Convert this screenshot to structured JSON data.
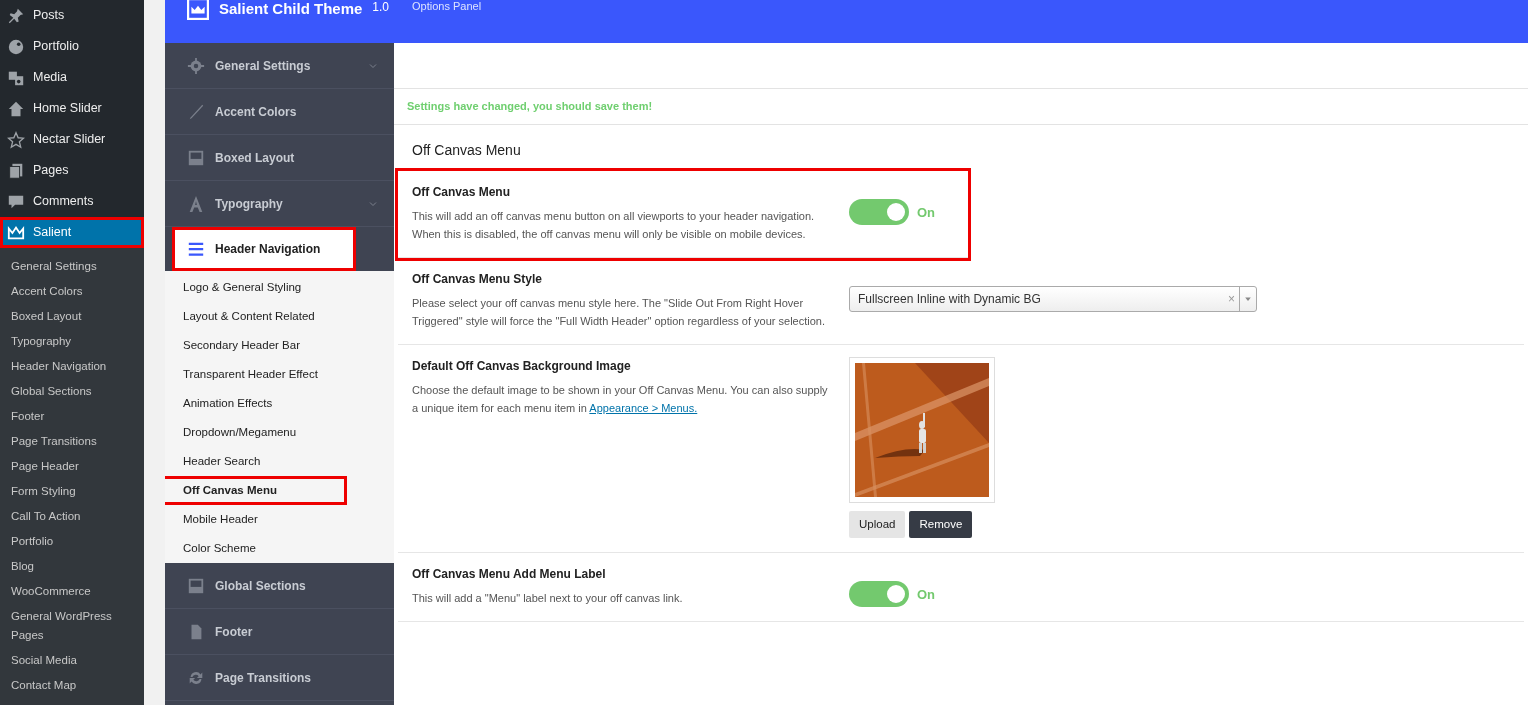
{
  "admin_menu": {
    "items": [
      {
        "label": "Posts",
        "selected": false,
        "highlighted": false
      },
      {
        "label": "Portfolio",
        "selected": false,
        "highlighted": false
      },
      {
        "label": "Media",
        "selected": false,
        "highlighted": false
      },
      {
        "label": "Home Slider",
        "selected": false,
        "highlighted": false
      },
      {
        "label": "Nectar Slider",
        "selected": false,
        "highlighted": false
      },
      {
        "label": "Pages",
        "selected": false,
        "highlighted": false
      },
      {
        "label": "Comments",
        "selected": false,
        "highlighted": false
      },
      {
        "label": "Salient",
        "selected": true,
        "highlighted": true
      }
    ],
    "submenu": [
      "General Settings",
      "Accent Colors",
      "Boxed Layout",
      "Typography",
      "Header Navigation",
      "Global Sections",
      "Footer",
      "Page Transitions",
      "Page Header",
      "Form Styling",
      "Call To Action",
      "Portfolio",
      "Blog",
      "WooCommerce",
      "General WordPress Pages",
      "Social Media",
      "Contact Map"
    ]
  },
  "header": {
    "title": "Salient Child Theme",
    "version": "1.0",
    "subtitle": "Options Panel"
  },
  "sections": [
    {
      "label": "General Settings",
      "selected": false,
      "highlighted": false,
      "expandable": true
    },
    {
      "label": "Accent Colors",
      "selected": false,
      "highlighted": false,
      "expandable": false
    },
    {
      "label": "Boxed Layout",
      "selected": false,
      "highlighted": false,
      "expandable": false
    },
    {
      "label": "Typography",
      "selected": false,
      "highlighted": false,
      "expandable": true
    },
    {
      "label": "Header Navigation",
      "selected": true,
      "highlighted": true,
      "expandable": false,
      "children": [
        {
          "label": "Logo & General Styling",
          "selected": false,
          "highlighted": false
        },
        {
          "label": "Layout & Content Related",
          "selected": false,
          "highlighted": false
        },
        {
          "label": "Secondary Header Bar",
          "selected": false,
          "highlighted": false
        },
        {
          "label": "Transparent Header Effect",
          "selected": false,
          "highlighted": false
        },
        {
          "label": "Animation Effects",
          "selected": false,
          "highlighted": false
        },
        {
          "label": "Dropdown/Megamenu",
          "selected": false,
          "highlighted": false
        },
        {
          "label": "Header Search",
          "selected": false,
          "highlighted": false
        },
        {
          "label": "Off Canvas Menu",
          "selected": true,
          "highlighted": true
        },
        {
          "label": "Mobile Header",
          "selected": false,
          "highlighted": false
        },
        {
          "label": "Color Scheme",
          "selected": false,
          "highlighted": false
        }
      ]
    },
    {
      "label": "Global Sections",
      "selected": false,
      "highlighted": false,
      "expandable": false
    },
    {
      "label": "Footer",
      "selected": false,
      "highlighted": false,
      "expandable": false
    },
    {
      "label": "Page Transitions",
      "selected": false,
      "highlighted": false,
      "expandable": false
    }
  ],
  "notice": "Settings have changed, you should save them!",
  "page_title": "Off Canvas Menu",
  "fields": [
    {
      "kind": "switch",
      "title": "Off Canvas Menu",
      "description": "This will add an off canvas menu button on all viewports to your header navigation. When this is disabled, the off canvas menu will only be visible on mobile devices.",
      "on": true,
      "state_label": "On",
      "highlighted": true
    },
    {
      "kind": "select",
      "title": "Off Canvas Menu Style",
      "description": "Please select your off canvas menu style here. The \"Slide Out From Right Hover Triggered\" style will force the \"Full Width Header\" option regardless of your selection.",
      "value": "Fullscreen Inline with Dynamic BG",
      "clear": "×",
      "highlighted": false
    },
    {
      "kind": "media",
      "title": "Default Off Canvas Background Image",
      "description": "Choose the default image to be shown in your Off Canvas Menu. You can also supply a unique item for each menu item in ",
      "link": "Appearance > Menus.",
      "buttons": [
        "Upload",
        "Remove"
      ],
      "highlighted": false
    },
    {
      "kind": "switch",
      "title": "Off Canvas Menu Add Menu Label",
      "description": "This will add a \"Menu\" label next to your off canvas link.",
      "on": true,
      "state_label": "On",
      "highlighted": false
    }
  ]
}
